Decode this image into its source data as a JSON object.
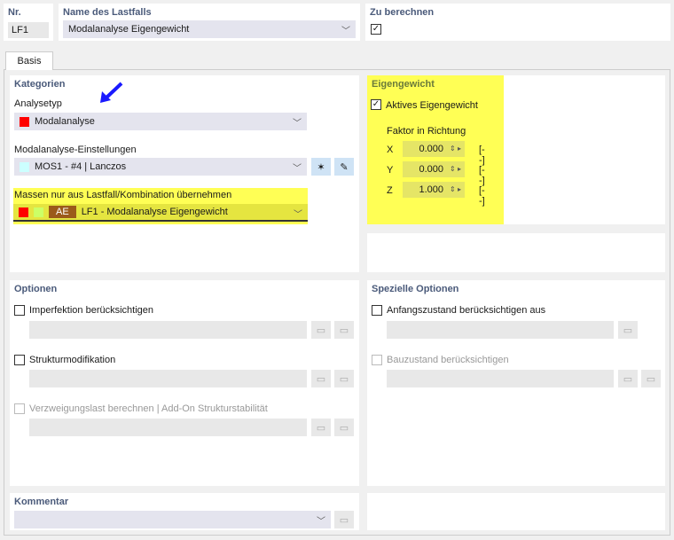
{
  "header": {
    "nr_label": "Nr.",
    "nr_value": "LF1",
    "name_label": "Name des Lastfalls",
    "name_value": "Modalanalyse Eigengewicht",
    "calc_label": "Zu berechnen",
    "calc_checked": true
  },
  "tabs": [
    {
      "label": "Basis"
    }
  ],
  "kategorien": {
    "title": "Kategorien",
    "analysetyp_label": "Analysetyp",
    "analysetyp_value": "Modalanalyse",
    "modal_label": "Modalanalyse-Einstellungen",
    "modal_value": "MOS1 - #4 | Lanczos",
    "massen_label": "Massen nur aus Lastfall/Kombination  übernehmen",
    "massen_badge": "AE",
    "massen_value": "LF1 - Modalanalyse Eigengewicht"
  },
  "eigengewicht": {
    "title": "Eigengewicht",
    "active_label": "Aktives Eigengewicht",
    "active_checked": true,
    "factor_label": "Faktor in Richtung",
    "rows": [
      {
        "axis": "X",
        "value": "0.000",
        "unit": "[--]"
      },
      {
        "axis": "Y",
        "value": "0.000",
        "unit": "[--]"
      },
      {
        "axis": "Z",
        "value": "1.000",
        "unit": "[--]"
      }
    ]
  },
  "optionen": {
    "title": "Optionen",
    "items": [
      {
        "label": "Imperfektion berücksichtigen",
        "enabled": true
      },
      {
        "label": "Strukturmodifikation",
        "enabled": true
      },
      {
        "label": "Verzweigungslast berechnen | Add-On Strukturstabilität",
        "enabled": false
      }
    ]
  },
  "spezielle": {
    "title": "Spezielle Optionen",
    "items": [
      {
        "label": "Anfangszustand berücksichtigen aus",
        "enabled": true
      },
      {
        "label": "Bauzustand berücksichtigen",
        "enabled": false
      }
    ]
  },
  "kommentar": {
    "title": "Kommentar"
  },
  "colors": {
    "highlight": "#ffff55",
    "red": "#ff0000",
    "badge": "#9b5a1a",
    "title": "#4a5a7a"
  }
}
